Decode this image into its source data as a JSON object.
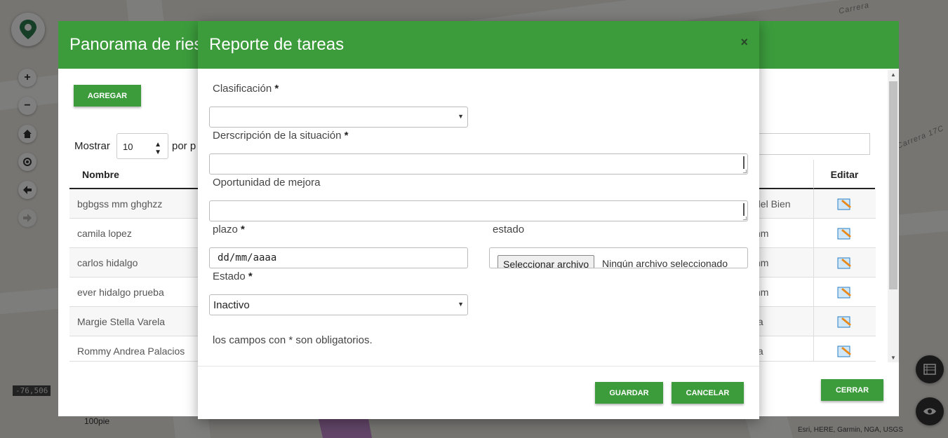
{
  "map": {
    "coordinate_readout": "-76,506",
    "scale_label": "100pie",
    "attribution": "Esri, HERE, Garmin, NGA, USGS",
    "street_labels": [
      "Carrera",
      "Carrera 17C"
    ]
  },
  "colors": {
    "brand_green": "#3c9c3c"
  },
  "background_modal": {
    "title": "Panorama de ries",
    "add_button": "AGREGAR",
    "show_label": "Mostrar",
    "page_length": "10",
    "per_label": "por p",
    "columns": {
      "name": "Nombre",
      "edit": "Editar"
    },
    "rows": [
      {
        "name": "bgbgss mm ghghzz",
        "right": "del Bien"
      },
      {
        "name": "camila lopez",
        "right": "nm"
      },
      {
        "name": "carlos hidalgo",
        "right": "nm"
      },
      {
        "name": "ever hidalgo prueba",
        "right": "nm"
      },
      {
        "name": "Margie Stella Varela",
        "right": "ía"
      },
      {
        "name": "Rommy Andrea Palacios",
        "right": "ía"
      }
    ],
    "close_button": "CERRAR"
  },
  "form_modal": {
    "title": "Reporte de tareas",
    "close_symbol": "×",
    "required_mark": "*",
    "fields": {
      "clasificacion": {
        "label": "Clasificación",
        "value": ""
      },
      "descripcion": {
        "label": "Derscripción de la situación"
      },
      "oportunidad": {
        "label": "Oportunidad de mejora"
      },
      "plazo": {
        "label": "plazo",
        "placeholder": "dd/mm/aaaa"
      },
      "archivo": {
        "label": "estado",
        "button": "Seleccionar archivo",
        "status": "Ningún archivo seleccionado"
      },
      "estado": {
        "label": "Estado",
        "value": "Inactivo"
      }
    },
    "note": "los campos con * son obligatorios.",
    "save_button": "GUARDAR",
    "cancel_button": "CANCELAR"
  }
}
